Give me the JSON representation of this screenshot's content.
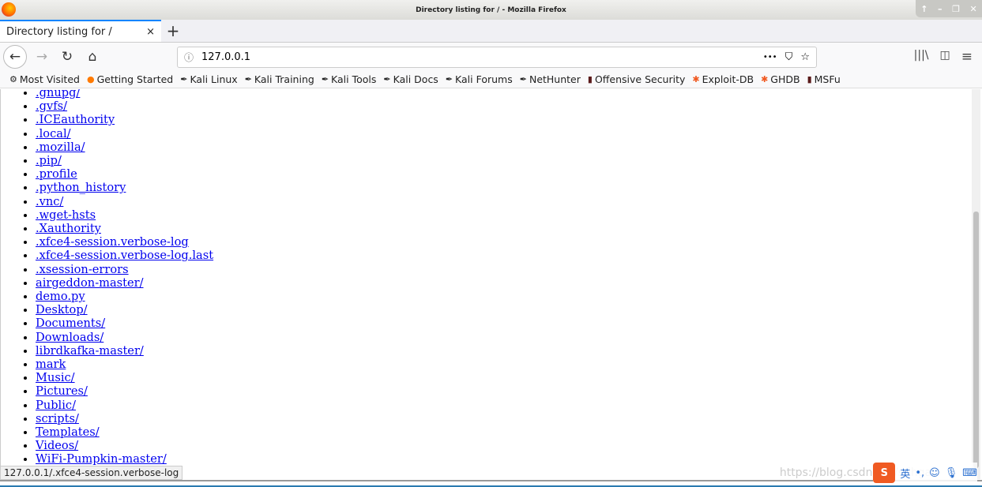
{
  "window": {
    "title": "Directory listing for / - Mozilla Firefox",
    "controls": [
      "↑",
      "–",
      "❐",
      "✕"
    ]
  },
  "tab": {
    "label": "Directory listing for /",
    "close": "×",
    "new": "+"
  },
  "nav": {
    "url": "127.0.0.1",
    "back": "←",
    "forward": "→",
    "reload": "↻",
    "home": "⌂",
    "more": "•••",
    "pocket": "⛉",
    "star": "☆",
    "library": "|||\\",
    "sidebar": "◫",
    "menu": "≡"
  },
  "bookmarks": [
    {
      "label": "Most Visited",
      "icon": "gear-icon",
      "glyph": "⚙"
    },
    {
      "label": "Getting Started",
      "icon": "firefox-icon",
      "glyph": "●"
    },
    {
      "label": "Kali Linux",
      "icon": "kali-icon",
      "glyph": "✒"
    },
    {
      "label": "Kali Training",
      "icon": "kali-icon",
      "glyph": "✒"
    },
    {
      "label": "Kali Tools",
      "icon": "kali-icon",
      "glyph": "✒"
    },
    {
      "label": "Kali Docs",
      "icon": "kali-icon",
      "glyph": "✒"
    },
    {
      "label": "Kali Forums",
      "icon": "kali-icon",
      "glyph": "✒"
    },
    {
      "label": "NetHunter",
      "icon": "kali-icon",
      "glyph": "✒"
    },
    {
      "label": "Offensive Security",
      "icon": "offsec-icon",
      "glyph": "▮"
    },
    {
      "label": "Exploit-DB",
      "icon": "bug-icon",
      "glyph": "✱"
    },
    {
      "label": "GHDB",
      "icon": "bug-icon",
      "glyph": "✱"
    },
    {
      "label": "MSFu",
      "icon": "offsec-icon",
      "glyph": "▮"
    }
  ],
  "files": [
    ".gnupg/",
    ".gvfs/",
    ".ICEauthority",
    ".local/",
    ".mozilla/",
    ".pip/",
    ".profile",
    ".python_history",
    ".vnc/",
    ".wget-hsts",
    ".Xauthority",
    ".xfce4-session.verbose-log",
    ".xfce4-session.verbose-log.last",
    ".xsession-errors",
    "airgeddon-master/",
    "demo.py",
    "Desktop/",
    "Documents/",
    "Downloads/",
    "librdkafka-master/",
    "mark",
    "Music/",
    "Pictures/",
    "Public/",
    "scripts/",
    "Templates/",
    "Videos/",
    "WiFi-Pumpkin-master/"
  ],
  "status": "127.0.0.1/.xfce4-session.verbose-log",
  "watermark": "https://blog.csdn.net/sdhgai",
  "ime": {
    "logo": "S",
    "lang": "英",
    "punct": "•,",
    "emoji": "☺",
    "mic": "🎙",
    "keyboard": "⌨"
  }
}
